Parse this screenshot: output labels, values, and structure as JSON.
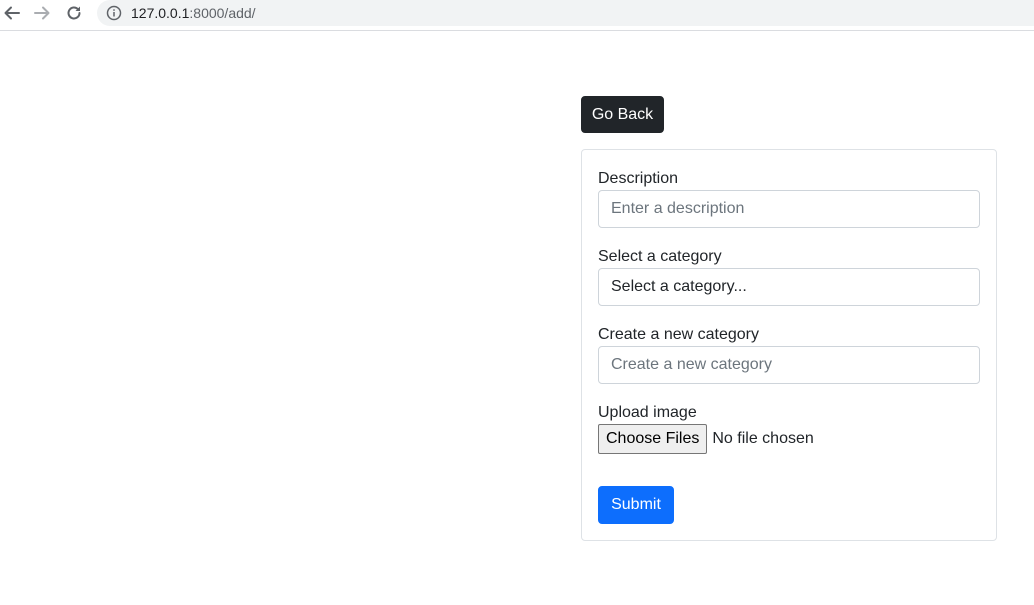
{
  "browser": {
    "url_host": "127.0.0.1",
    "url_rest": ":8000/add/"
  },
  "page": {
    "go_back_label": "Go Back",
    "form": {
      "description": {
        "label": "Description",
        "placeholder": "Enter a description",
        "value": ""
      },
      "category": {
        "label": "Select a category",
        "selected": "Select a category..."
      },
      "new_category": {
        "label": "Create a new category",
        "placeholder": "Create a new category",
        "value": ""
      },
      "upload": {
        "label": "Upload image",
        "button_label": "Choose Files",
        "status": "No file chosen"
      },
      "submit_label": "Submit"
    }
  },
  "colors": {
    "dark_button": "#212529",
    "primary_button": "#0d6efd",
    "border": "#dee2e6",
    "placeholder": "#6c757d"
  },
  "icons": [
    "back-arrow-icon",
    "forward-arrow-icon",
    "reload-icon",
    "info-icon"
  ]
}
